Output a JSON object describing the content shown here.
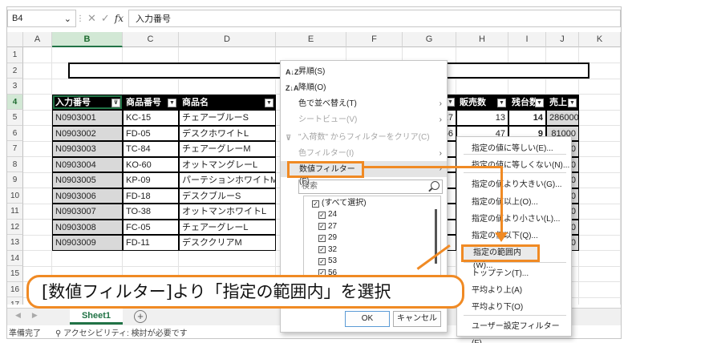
{
  "formula_bar": {
    "name_box": "B4",
    "fx_label": "fx",
    "content": "入力番号"
  },
  "columns": [
    "A",
    "B",
    "C",
    "D",
    "E",
    "F",
    "G",
    "H",
    "I",
    "J",
    "K"
  ],
  "rows": [
    "1",
    "2",
    "3",
    "4",
    "5",
    "6",
    "7",
    "8",
    "9",
    "10",
    "11",
    "12",
    "13",
    "14",
    "15",
    "16",
    "17"
  ],
  "table": {
    "headers": [
      "入力番号",
      "商品番号",
      "商品名",
      "販売数",
      "残台数",
      "売上"
    ],
    "rows": [
      {
        "id": "N0903001",
        "code": "KC-15",
        "name": "チェアーブルーS",
        "g": "27",
        "sales": "13",
        "stock": "14",
        "revenue": "286000",
        "stock_bold": true
      },
      {
        "id": "N0903002",
        "code": "FD-05",
        "name": "デスクホワイトL",
        "g": "56",
        "sales": "47",
        "stock": "9",
        "revenue": "81000",
        "stock_bold": true
      },
      {
        "id": "N0903003",
        "code": "TC-84",
        "name": "チェアーグレーM",
        "g": "",
        "sales": "",
        "stock": "",
        "revenue": "7000",
        "stock_bold": false
      },
      {
        "id": "N0903004",
        "code": "KO-60",
        "name": "オットマングレーL",
        "g": "",
        "sales": "",
        "stock": "",
        "revenue": "7000",
        "stock_bold": false
      },
      {
        "id": "N0903005",
        "code": "KP-09",
        "name": "パーテションホワイトM",
        "g": "",
        "sales": "",
        "stock": "",
        "revenue": "0000",
        "stock_bold": false
      },
      {
        "id": "N0903006",
        "code": "FD-18",
        "name": "デスクブルーS",
        "g": "",
        "sales": "",
        "stock": "",
        "revenue": "5000",
        "stock_bold": false
      },
      {
        "id": "N0903007",
        "code": "TO-38",
        "name": "オットマンホワイトL",
        "g": "",
        "sales": "",
        "stock": "",
        "revenue": "0000",
        "stock_bold": false
      },
      {
        "id": "N0903008",
        "code": "FC-05",
        "name": "チェアーグレーL",
        "g": "",
        "sales": "",
        "stock": "",
        "revenue": "0000",
        "stock_bold": false
      },
      {
        "id": "N0903009",
        "code": "FD-11",
        "name": "デスククリアM",
        "g": "",
        "sales": "",
        "stock": "",
        "revenue": "5000",
        "stock_bold": false
      }
    ]
  },
  "menu": {
    "sort_asc": "昇順(S)",
    "sort_desc": "降順(O)",
    "sort_color": "色で並べ替え(T)",
    "sheet_view": "シートビュー(V)",
    "clear_filter": "\"入荷数\" からフィルターをクリア(C)",
    "color_filter": "色フィルター(I)",
    "number_filter": "数値フィルター(F)",
    "search_placeholder": "検索",
    "select_all": "(すべて選択)",
    "values": [
      "24",
      "27",
      "29",
      "32",
      "53",
      "56"
    ],
    "ok": "OK",
    "cancel": "キャンセル"
  },
  "submenu": {
    "items": [
      "指定の値に等しい(E)...",
      "指定の値に等しくない(N)...",
      "指定の値より大きい(G)...",
      "指定の値以上(O)...",
      "指定の値より小さい(L)...",
      "指定の値以下(Q)...",
      "指定の範囲内(W)...",
      "トップテン(T)...",
      "平均より上(A)",
      "平均より下(O)",
      "ユーザー設定フィルター(F)..."
    ]
  },
  "callout": {
    "text": "[数値フィルター]より「指定の範囲内」を選択"
  },
  "tabs": {
    "sheet": "Sheet1",
    "add": "+"
  },
  "status": {
    "ready": "準備完了",
    "accessibility": "アクセシビリティ: 検討が必要です"
  },
  "colors": {
    "accent": "#f08a24",
    "excel_green": "#217346",
    "header_black": "#000000",
    "row_gray": "#d9d9d9"
  }
}
